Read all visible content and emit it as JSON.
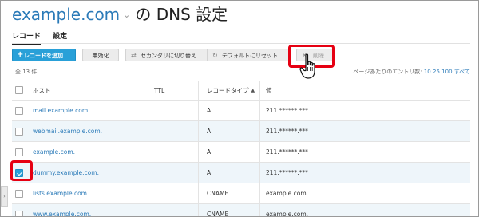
{
  "header": {
    "domain": "example.com",
    "title_suffix": "の DNS 設定"
  },
  "tabs": [
    {
      "label": "レコード",
      "active": true
    },
    {
      "label": "設定",
      "active": false
    }
  ],
  "toolbar": {
    "add_label": "レコードを追加",
    "disable_label": "無効化",
    "secondary_label": "セカンダリに切り替え",
    "reset_label": "デフォルトにリセット",
    "delete_label": "削除"
  },
  "summary": {
    "count_label": "全 13 件",
    "pager_prefix": "ページあたりのエントリ数:",
    "pager_10": "10",
    "pager_25": "25",
    "pager_100": "100",
    "pager_all": "すべて"
  },
  "table": {
    "headers": {
      "host": "ホスト",
      "ttl": "TTL",
      "type": "レコードタイプ",
      "value": "値"
    },
    "rows": [
      {
        "host": "mail.example.com.",
        "ttl": "",
        "type": "A",
        "value": "211.******.***",
        "checked": false
      },
      {
        "host": "webmail.example.com.",
        "ttl": "",
        "type": "A",
        "value": "211.******.***",
        "checked": false
      },
      {
        "host": "example.com.",
        "ttl": "",
        "type": "A",
        "value": "211.******.***",
        "checked": false
      },
      {
        "host": "dummy.example.com.",
        "ttl": "",
        "type": "A",
        "value": "211.******.***",
        "checked": true
      },
      {
        "host": "lists.example.com.",
        "ttl": "",
        "type": "CNAME",
        "value": "example.com.",
        "checked": false
      },
      {
        "host": "www.example.com.",
        "ttl": "",
        "type": "CNAME",
        "value": "example.com.",
        "checked": false
      }
    ]
  },
  "colors": {
    "accent": "#29a0d8",
    "link": "#2a7ab8",
    "highlight": "#e60012"
  },
  "icons": {
    "add": "plus-icon",
    "secondary": "swap-icon",
    "reset": "reset-icon",
    "delete": "close-icon",
    "cursor": "hand-pointer-icon"
  }
}
